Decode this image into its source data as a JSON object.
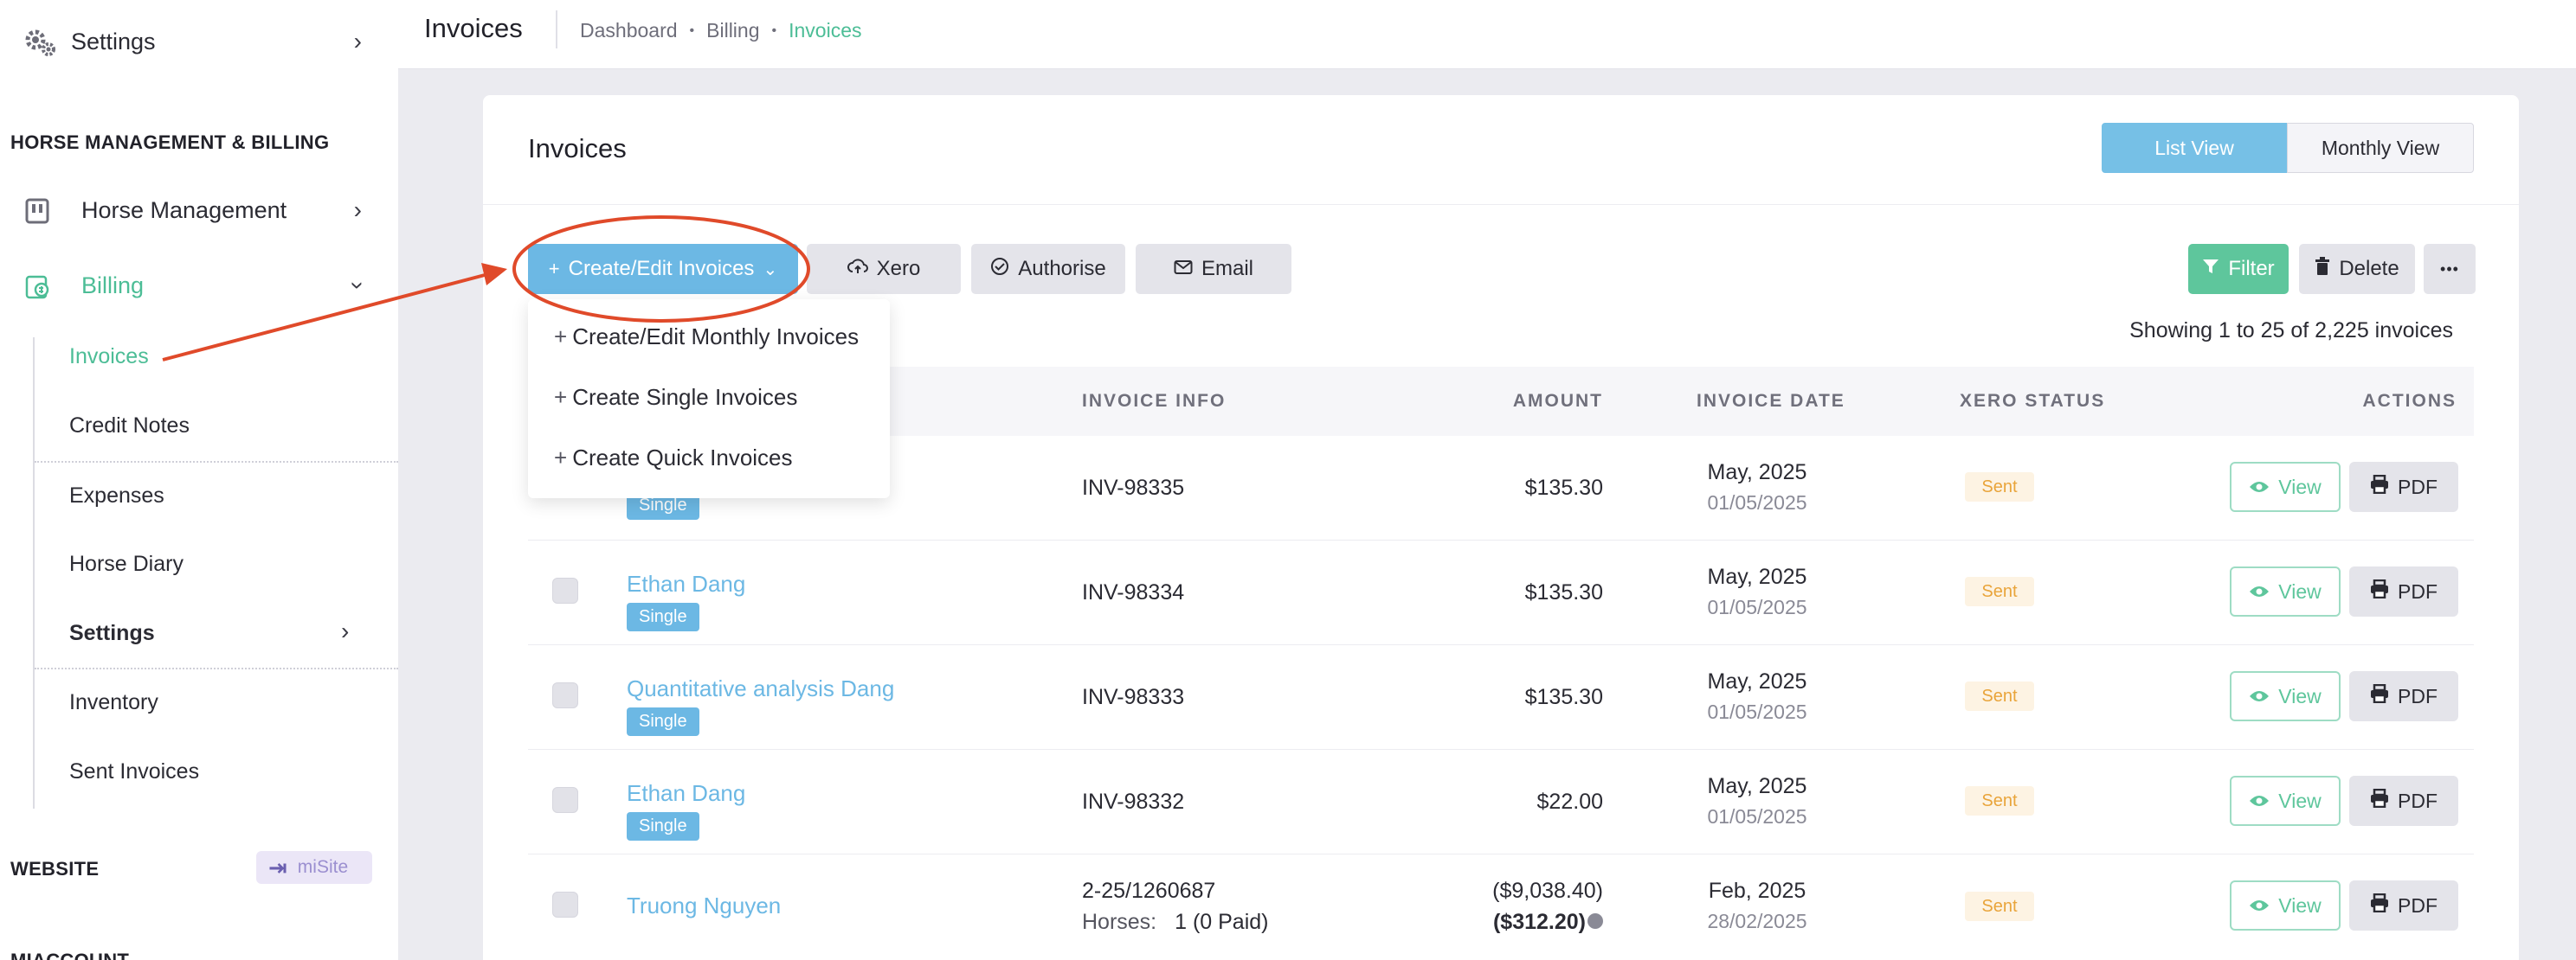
{
  "sidebar": {
    "top_item": "Settings",
    "section_horse": "HORSE MANAGEMENT & BILLING",
    "horse_management": "Horse Management",
    "billing": "Billing",
    "sub": {
      "invoices": "Invoices",
      "credit_notes": "Credit Notes",
      "expenses": "Expenses",
      "horse_diary": "Horse Diary",
      "settings": "Settings",
      "inventory": "Inventory",
      "sent_invoices": "Sent Invoices"
    },
    "section_website": "WEBSITE",
    "misite": "miSite",
    "section_account": "MIACCOUNT"
  },
  "header": {
    "title": "Invoices",
    "breadcrumbs": [
      "Dashboard",
      "Billing",
      "Invoices"
    ]
  },
  "card": {
    "title": "Invoices",
    "list_view": "List View",
    "monthly_view": "Monthly View"
  },
  "toolbar": {
    "create": "Create/Edit Invoices",
    "xero": "Xero",
    "authorise": "Authorise",
    "email": "Email",
    "filter": "Filter",
    "delete": "Delete",
    "more": "•••"
  },
  "dropdown": {
    "monthly": "Create/Edit Monthly Invoices",
    "single": "Create Single Invoices",
    "quick": "Create Quick Invoices"
  },
  "showing": "Showing 1 to 25 of 2,225 invoices",
  "table": {
    "headers": {
      "invoice_info": "INVOICE INFO",
      "amount": "AMOUNT",
      "invoice_date": "INVOICE DATE",
      "xero_status": "XERO STATUS",
      "actions": "ACTIONS"
    },
    "view_label": "View",
    "pdf_label": "PDF",
    "rows": [
      {
        "name": "",
        "badge": "Single",
        "invoice": "INV-98335",
        "amount": "$135.30",
        "date": "May, 2025",
        "date_sub": "01/05/2025",
        "status": "Sent"
      },
      {
        "name": "Ethan Dang",
        "badge": "Single",
        "invoice": "INV-98334",
        "amount": "$135.30",
        "date": "May, 2025",
        "date_sub": "01/05/2025",
        "status": "Sent"
      },
      {
        "name": "Quantitative analysis Dang",
        "badge": "Single",
        "invoice": "INV-98333",
        "amount": "$135.30",
        "date": "May, 2025",
        "date_sub": "01/05/2025",
        "status": "Sent"
      },
      {
        "name": "Ethan Dang",
        "badge": "Single",
        "invoice": "INV-98332",
        "amount": "$22.00",
        "date": "May, 2025",
        "date_sub": "01/05/2025",
        "status": "Sent"
      },
      {
        "name": "Truong Nguyen",
        "badge": "",
        "invoice": "2-25/1260687",
        "horses_label": "Horses:",
        "horses_value": "1 (0 Paid)",
        "amount": "($9,038.40)",
        "amount_bold": "($312.20)",
        "date": "Feb, 2025",
        "date_sub": "28/02/2025",
        "status": "Sent"
      }
    ]
  },
  "colors": {
    "accent_green": "#4cbd96",
    "accent_blue": "#6cb8e4",
    "annotation_red": "#e04a2a"
  }
}
